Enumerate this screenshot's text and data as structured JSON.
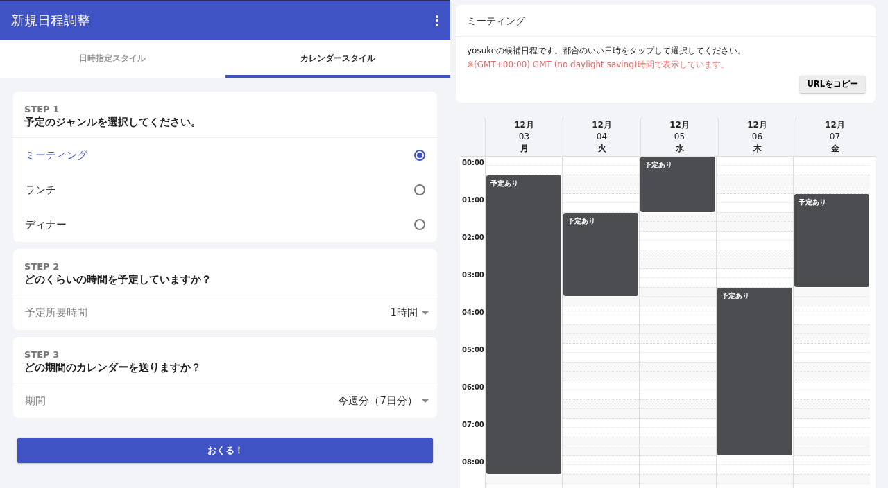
{
  "app_bar": {
    "title": "新規日程調整"
  },
  "tabs": [
    {
      "label": "日時指定スタイル",
      "selected": false
    },
    {
      "label": "カレンダースタイル",
      "selected": true
    }
  ],
  "steps": [
    {
      "kind": "radio",
      "step": "STEP 1",
      "question": "予定のジャンルを選択してください。",
      "options": [
        {
          "label": "ミーティング",
          "selected": true
        },
        {
          "label": "ランチ",
          "selected": false
        },
        {
          "label": "ディナー",
          "selected": false
        }
      ]
    },
    {
      "kind": "select",
      "step": "STEP 2",
      "question": "どのくらいの時間を予定していますか？",
      "label": "予定所要時間",
      "value": "1時間"
    },
    {
      "kind": "select",
      "step": "STEP 3",
      "question": "どの期間のカレンダーを送りますか？",
      "label": "期間",
      "value": "今週分（7日分）"
    }
  ],
  "submit_button": "おくる！",
  "preview": {
    "title": "ミーティング",
    "message": "yosukeの候補日程です。都合のいい日時をタップして選択してください。",
    "timezone_note": "※(GMT+00:00) GMT (no daylight saving)時間で表示しています。",
    "copy_button": "URLをコピー"
  },
  "calendar": {
    "days": [
      {
        "month": "12月",
        "date": "03",
        "weekday": "月",
        "event_label": "予定あり",
        "quarters_busy": [
          false,
          false,
          true,
          true,
          true,
          true,
          true,
          true,
          true,
          true,
          true,
          true,
          true,
          true,
          true,
          true,
          true,
          true,
          true,
          true,
          true,
          true,
          true,
          true,
          true,
          true,
          true,
          true,
          true,
          true,
          true,
          true,
          true,
          true,
          false
        ]
      },
      {
        "month": "12月",
        "date": "04",
        "weekday": "火",
        "event_label": "予定あり",
        "quarters_busy": [
          false,
          false,
          false,
          false,
          false,
          false,
          true,
          true,
          true,
          true,
          true,
          true,
          true,
          true,
          true,
          false,
          false,
          false,
          false,
          false,
          false,
          false,
          false,
          false,
          false,
          false,
          false,
          false,
          false,
          false,
          false,
          false,
          false,
          false,
          false
        ]
      },
      {
        "month": "12月",
        "date": "05",
        "weekday": "水",
        "event_label": "予定あり",
        "quarters_busy": [
          true,
          true,
          true,
          true,
          true,
          true,
          false,
          false,
          false,
          false,
          false,
          false,
          false,
          false,
          false,
          false,
          false,
          false,
          false,
          false,
          false,
          false,
          false,
          false,
          false,
          false,
          false,
          false,
          false,
          false,
          false,
          false,
          false,
          false,
          false
        ]
      },
      {
        "month": "12月",
        "date": "06",
        "weekday": "木",
        "event_label": "予定あり",
        "quarters_busy": [
          false,
          false,
          false,
          false,
          false,
          false,
          false,
          false,
          false,
          false,
          false,
          false,
          false,
          false,
          true,
          true,
          true,
          true,
          true,
          true,
          true,
          true,
          true,
          true,
          true,
          true,
          true,
          true,
          true,
          true,
          true,
          true,
          false,
          false,
          false
        ]
      },
      {
        "month": "12月",
        "date": "07",
        "weekday": "金",
        "event_label": "予定あり",
        "quarters_busy": [
          false,
          false,
          false,
          false,
          true,
          true,
          true,
          true,
          true,
          true,
          true,
          true,
          true,
          true,
          false,
          false,
          false,
          false,
          false,
          false,
          false,
          false,
          false,
          false,
          false,
          false,
          false,
          false,
          false,
          false,
          false,
          false,
          false,
          false,
          false
        ]
      }
    ],
    "times": [
      "00:00",
      "01:00",
      "02:00",
      "03:00",
      "04:00",
      "05:00",
      "06:00",
      "07:00",
      "08:00"
    ]
  }
}
